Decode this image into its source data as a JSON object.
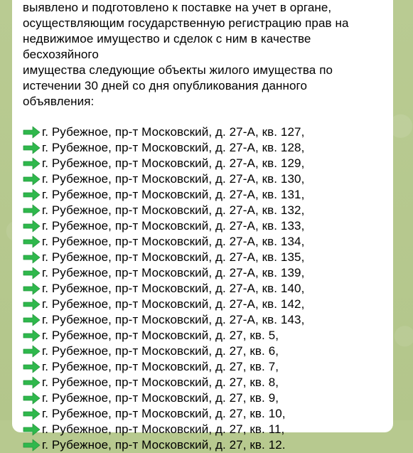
{
  "message": {
    "intro_text": "выявлено и подготовлено к поставке на учет в органе,\nосуществляющим государственную регистрацию прав на\nнедвижимое имущество и сделок с ним в качестве бесхозяйного\nимущества следующие объекты жилого имущества по\nистечении 30 дней со дня опубликования данного объявления:",
    "arrow_icon": "green-right-arrow-emoji",
    "arrow_color": "#2fb84c",
    "addresses": [
      "г. Рубежное, пр-т Московский, д. 27-А, кв. 127,",
      "г. Рубежное, пр-т Московский, д. 27-А, кв. 128,",
      "г. Рубежное, пр-т Московский, д. 27-А, кв. 129,",
      "г. Рубежное, пр-т Московский, д. 27-А, кв. 130,",
      "г. Рубежное, пр-т Московский, д. 27-А, кв. 131,",
      "г. Рубежное, пр-т Московский, д. 27-А, кв. 132,",
      "г. Рубежное, пр-т Московский, д. 27-А, кв. 133,",
      "г. Рубежное, пр-т Московский, д. 27-А, кв. 134,",
      "г. Рубежное, пр-т Московский, д. 27-А, кв. 135,",
      "г. Рубежное, пр-т Московский, д. 27-А, кв. 139,",
      "г. Рубежное, пр-т Московский, д. 27-А, кв. 140,",
      "г. Рубежное, пр-т Московский, д. 27-А, кв. 142,",
      "г. Рубежное, пр-т Московский, д. 27-А, кв. 143,",
      "г. Рубежное, пр-т Московский, д. 27, кв. 5,",
      "г. Рубежное, пр-т Московский, д. 27, кв. 6,",
      "г. Рубежное, пр-т Московский, д. 27, кв. 7,",
      "г. Рубежное, пр-т Московский, д. 27, кв. 8,",
      "г. Рубежное, пр-т Московский, д. 27, кв. 9,",
      "г. Рубежное, пр-т Московский, д. 27, кв. 10,",
      "г. Рубежное, пр-т Московский, д. 27, кв. 11,",
      "г. Рубежное, пр-т Московский, д. 27, кв. 12."
    ]
  }
}
